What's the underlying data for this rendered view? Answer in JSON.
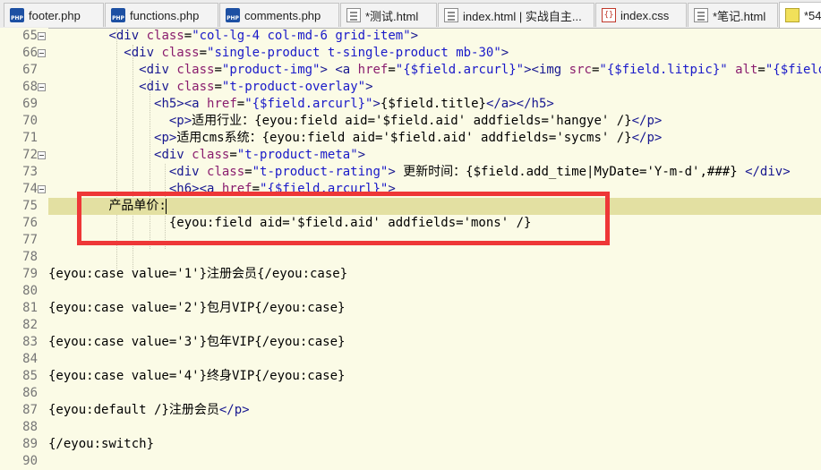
{
  "tabs": [
    {
      "label": "footer.php",
      "icon": "php-file-icon",
      "active": false
    },
    {
      "label": "functions.php",
      "icon": "php-file-icon",
      "active": false
    },
    {
      "label": "comments.php",
      "icon": "php-file-icon",
      "active": false
    },
    {
      "label": "*测试.html",
      "icon": "html-file-icon",
      "active": false
    },
    {
      "label": "index.html | 实战自主...",
      "icon": "html-file-icon",
      "active": false
    },
    {
      "label": "index.css",
      "icon": "css-file-icon",
      "active": false
    },
    {
      "label": "*笔记.html",
      "icon": "html-file-icon",
      "active": false
    },
    {
      "label": "*54",
      "icon": "js-file-icon",
      "active": true
    }
  ],
  "lines": [
    {
      "number": "65",
      "fold": true,
      "segments": [
        {
          "text": "        ",
          "c": "tx"
        },
        {
          "text": "<div ",
          "c": "tg"
        },
        {
          "text": "class",
          "c": "at"
        },
        {
          "text": "=",
          "c": "tx"
        },
        {
          "text": "\"col-lg-4 col-md-6 grid-item\"",
          "c": "st"
        },
        {
          "text": ">",
          "c": "tg"
        }
      ]
    },
    {
      "number": "66",
      "fold": true,
      "segments": [
        {
          "text": "          ",
          "c": "tx"
        },
        {
          "text": "<div ",
          "c": "tg"
        },
        {
          "text": "class",
          "c": "at"
        },
        {
          "text": "=",
          "c": "tx"
        },
        {
          "text": "\"single-product t-single-product mb-30\"",
          "c": "st"
        },
        {
          "text": ">",
          "c": "tg"
        }
      ]
    },
    {
      "number": "67",
      "fold": false,
      "segments": [
        {
          "text": "            ",
          "c": "tx"
        },
        {
          "text": "<div ",
          "c": "tg"
        },
        {
          "text": "class",
          "c": "at"
        },
        {
          "text": "=",
          "c": "tx"
        },
        {
          "text": "\"product-img\"",
          "c": "st"
        },
        {
          "text": "> ",
          "c": "tg"
        },
        {
          "text": "<a ",
          "c": "tg"
        },
        {
          "text": "href",
          "c": "at"
        },
        {
          "text": "=",
          "c": "tx"
        },
        {
          "text": "\"{$field.arcurl}\"",
          "c": "st"
        },
        {
          "text": "><img ",
          "c": "tg"
        },
        {
          "text": "src",
          "c": "at"
        },
        {
          "text": "=",
          "c": "tx"
        },
        {
          "text": "\"{$field.litpic}\"",
          "c": "st"
        },
        {
          "text": " alt",
          "c": "at"
        },
        {
          "text": "=",
          "c": "tx"
        },
        {
          "text": "\"{$field.title}\"",
          "c": "st"
        }
      ]
    },
    {
      "number": "68",
      "fold": true,
      "segments": [
        {
          "text": "            ",
          "c": "tx"
        },
        {
          "text": "<div ",
          "c": "tg"
        },
        {
          "text": "class",
          "c": "at"
        },
        {
          "text": "=",
          "c": "tx"
        },
        {
          "text": "\"t-product-overlay\"",
          "c": "st"
        },
        {
          "text": ">",
          "c": "tg"
        }
      ]
    },
    {
      "number": "69",
      "fold": false,
      "segments": [
        {
          "text": "              ",
          "c": "tx"
        },
        {
          "text": "<h5><a ",
          "c": "tg"
        },
        {
          "text": "href",
          "c": "at"
        },
        {
          "text": "=",
          "c": "tx"
        },
        {
          "text": "\"{$field.arcurl}\"",
          "c": "st"
        },
        {
          "text": ">",
          "c": "tg"
        },
        {
          "text": "{$field.title}",
          "c": "tx"
        },
        {
          "text": "</a></h5>",
          "c": "tg"
        }
      ]
    },
    {
      "number": "70",
      "fold": false,
      "segments": [
        {
          "text": "                ",
          "c": "tx"
        },
        {
          "text": "<p>",
          "c": "tg"
        },
        {
          "text": "适用行业：{eyou:field aid='$field.aid' addfields='hangye' /}",
          "c": "tx"
        },
        {
          "text": "</p>",
          "c": "tg"
        }
      ]
    },
    {
      "number": "71",
      "fold": false,
      "segments": [
        {
          "text": "              ",
          "c": "tx"
        },
        {
          "text": "<p>",
          "c": "tg"
        },
        {
          "text": "适用cms系统：{eyou:field aid='$field.aid' addfields='sycms' /}",
          "c": "tx"
        },
        {
          "text": "</p>",
          "c": "tg"
        }
      ]
    },
    {
      "number": "72",
      "fold": true,
      "segments": [
        {
          "text": "              ",
          "c": "tx"
        },
        {
          "text": "<div ",
          "c": "tg"
        },
        {
          "text": "class",
          "c": "at"
        },
        {
          "text": "=",
          "c": "tx"
        },
        {
          "text": "\"t-product-meta\"",
          "c": "st"
        },
        {
          "text": ">",
          "c": "tg"
        }
      ]
    },
    {
      "number": "73",
      "fold": false,
      "segments": [
        {
          "text": "                ",
          "c": "tx"
        },
        {
          "text": "<div ",
          "c": "tg"
        },
        {
          "text": "class",
          "c": "at"
        },
        {
          "text": "=",
          "c": "tx"
        },
        {
          "text": "\"t-product-rating\"",
          "c": "st"
        },
        {
          "text": "> ",
          "c": "tg"
        },
        {
          "text": "更新时间：{$field.add_time|MyDate='Y-m-d',###} ",
          "c": "tx"
        },
        {
          "text": "</div>",
          "c": "tg"
        }
      ]
    },
    {
      "number": "74",
      "fold": true,
      "segments": [
        {
          "text": "                ",
          "c": "tx"
        },
        {
          "text": "<h6><a ",
          "c": "tg"
        },
        {
          "text": "href",
          "c": "at"
        },
        {
          "text": "=",
          "c": "tx"
        },
        {
          "text": "\"{$field.arcurl}\"",
          "c": "st"
        },
        {
          "text": ">",
          "c": "tg"
        }
      ]
    },
    {
      "number": "75",
      "fold": false,
      "segments": [
        {
          "text": "        ",
          "c": "tx"
        },
        {
          "text": "产品单价:",
          "c": "tx"
        }
      ]
    },
    {
      "number": "76",
      "fold": false,
      "segments": [
        {
          "text": "                ",
          "c": "tx"
        },
        {
          "text": "{eyou:field aid='$field.aid' addfields='mons' /}",
          "c": "tx"
        }
      ]
    },
    {
      "number": "77",
      "fold": false,
      "segments": []
    },
    {
      "number": "78",
      "fold": false,
      "segments": []
    },
    {
      "number": "79",
      "fold": false,
      "segments": [
        {
          "text": "{eyou:case value='1'}注册会员{/eyou:case}",
          "c": "tx"
        }
      ]
    },
    {
      "number": "80",
      "fold": false,
      "segments": []
    },
    {
      "number": "81",
      "fold": false,
      "segments": [
        {
          "text": "{eyou:case value='2'}包月VIP{/eyou:case}",
          "c": "tx"
        }
      ]
    },
    {
      "number": "82",
      "fold": false,
      "segments": []
    },
    {
      "number": "83",
      "fold": false,
      "segments": [
        {
          "text": "{eyou:case value='3'}包年VIP{/eyou:case}",
          "c": "tx"
        }
      ]
    },
    {
      "number": "84",
      "fold": false,
      "segments": []
    },
    {
      "number": "85",
      "fold": false,
      "segments": [
        {
          "text": "{eyou:case value='4'}终身VIP{/eyou:case}",
          "c": "tx"
        }
      ]
    },
    {
      "number": "86",
      "fold": false,
      "segments": []
    },
    {
      "number": "87",
      "fold": false,
      "segments": [
        {
          "text": "{eyou:default /}注册会员",
          "c": "tx"
        },
        {
          "text": "</p>",
          "c": "tg"
        }
      ]
    },
    {
      "number": "88",
      "fold": false,
      "segments": []
    },
    {
      "number": "89",
      "fold": false,
      "segments": [
        {
          "text": "{/eyou:switch}",
          "c": "tx"
        }
      ]
    },
    {
      "number": "90",
      "fold": false,
      "segments": []
    }
  ],
  "current_line": "75",
  "annotation": {
    "color": "#ee3737"
  }
}
